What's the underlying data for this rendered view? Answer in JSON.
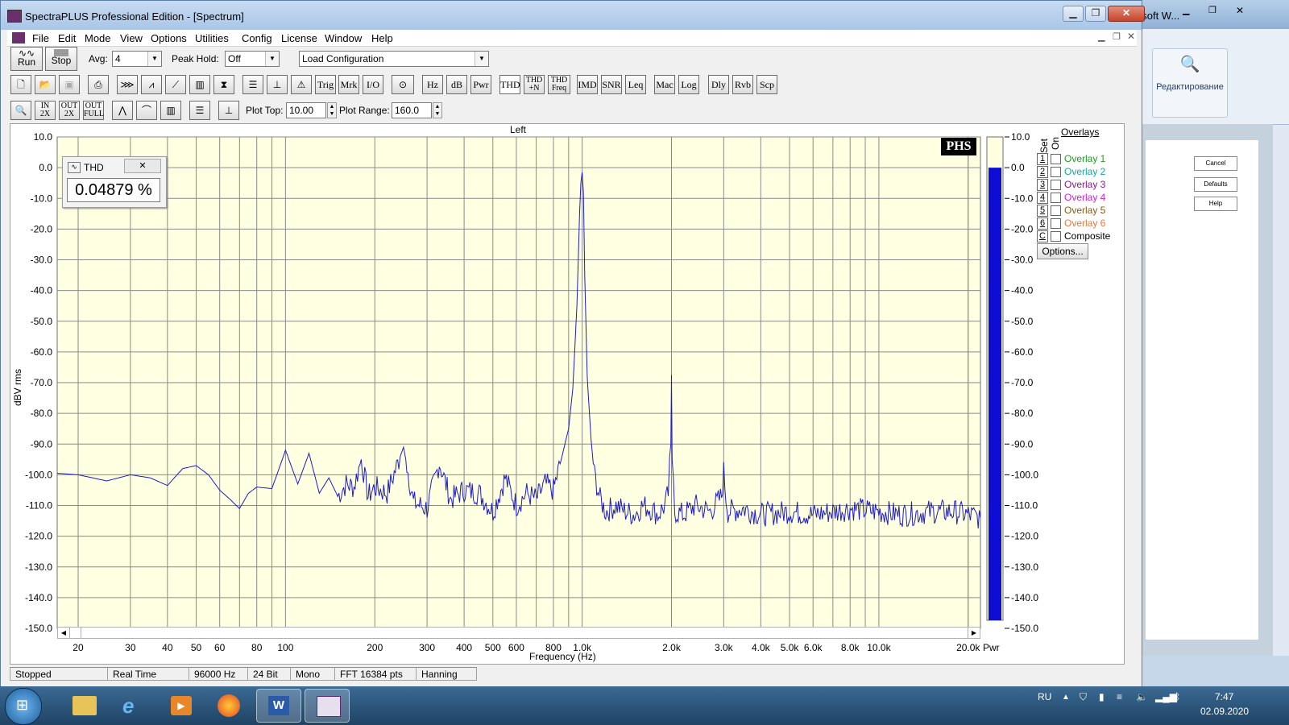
{
  "window": {
    "title": "SpectraPLUS Professional Edition - [Spectrum]",
    "menu": [
      "File",
      "Edit",
      "Mode",
      "View",
      "Options",
      "Utilities",
      "Config",
      "License",
      "Window",
      "Help"
    ]
  },
  "toolbar1": {
    "run_label": "Run",
    "stop_label": "Stop",
    "avg_label": "Avg:",
    "avg_value": "4",
    "peak_hold_label": "Peak Hold:",
    "peak_hold_value": "Off",
    "config_value": "Load Configuration"
  },
  "toolbar2": {
    "buttons": [
      "Trig",
      "Mrk",
      "I/O",
      "Hz",
      "dB",
      "Pwr",
      "THD",
      "THD +N",
      "THD Freq",
      "IMD",
      "SNR",
      "Leq",
      "Mac",
      "Log",
      "Dly",
      "Rvb",
      "Scp"
    ]
  },
  "toolbar3": {
    "zoom_labels": [
      "IN 2X",
      "OUT 2X",
      "OUT FULL"
    ],
    "plot_top_label": "Plot Top:",
    "plot_top_value": "10.00",
    "plot_range_label": "Plot Range:",
    "plot_range_value": "160.0"
  },
  "plot": {
    "channel": "Left",
    "brand": "PHS",
    "ylabel": "dBV rms",
    "xlabel": "Frequency (Hz)",
    "pwr_label": "Pwr",
    "pwr_level_db": 0.0,
    "thd_title": "THD",
    "thd_value": "0.04879 %",
    "y_ticks": [
      "10.0",
      "0.0",
      "-10.0",
      "-20.0",
      "-30.0",
      "-40.0",
      "-50.0",
      "-60.0",
      "-70.0",
      "-80.0",
      "-90.0",
      "-100.0",
      "-110.0",
      "-120.0",
      "-130.0",
      "-140.0",
      "-150.0"
    ],
    "x_ticks": [
      {
        "f": 20,
        "label": "20"
      },
      {
        "f": 30,
        "label": "30"
      },
      {
        "f": 40,
        "label": "40"
      },
      {
        "f": 50,
        "label": "50"
      },
      {
        "f": 60,
        "label": "60"
      },
      {
        "f": 80,
        "label": "80"
      },
      {
        "f": 100,
        "label": "100"
      },
      {
        "f": 200,
        "label": "200"
      },
      {
        "f": 300,
        "label": "300"
      },
      {
        "f": 400,
        "label": "400"
      },
      {
        "f": 500,
        "label": "500"
      },
      {
        "f": 600,
        "label": "600"
      },
      {
        "f": 800,
        "label": "800"
      },
      {
        "f": 1000,
        "label": "1.0k"
      },
      {
        "f": 2000,
        "label": "2.0k"
      },
      {
        "f": 3000,
        "label": "3.0k"
      },
      {
        "f": 4000,
        "label": "4.0k"
      },
      {
        "f": 5000,
        "label": "5.0k"
      },
      {
        "f": 6000,
        "label": "6.0k"
      },
      {
        "f": 8000,
        "label": "8.0k"
      },
      {
        "f": 10000,
        "label": "10.0k"
      },
      {
        "f": 20000,
        "label": "20.0k"
      }
    ]
  },
  "overlays": {
    "title": "Overlays",
    "set_label": "Set",
    "on_label": "On",
    "items": [
      {
        "key": "1",
        "label": "Overlay 1",
        "color": "#1e9b1e"
      },
      {
        "key": "2",
        "label": "Overlay 2",
        "color": "#1aa5a5"
      },
      {
        "key": "3",
        "label": "Overlay 3",
        "color": "#8b1a8b"
      },
      {
        "key": "4",
        "label": "Overlay 4",
        "color": "#d31ed3"
      },
      {
        "key": "5",
        "label": "Overlay 5",
        "color": "#8a5a1a"
      },
      {
        "key": "6",
        "label": "Overlay 6",
        "color": "#e07a40"
      },
      {
        "key": "C",
        "label": "Composite",
        "color": "#000000"
      }
    ],
    "options_label": "Options..."
  },
  "status": {
    "state": "Stopped",
    "mode": "Real Time",
    "rate": "96000 Hz",
    "bits": "24 Bit",
    "channels": "Mono",
    "fft": "FFT 16384 pts",
    "window": "Hanning"
  },
  "background_window": {
    "title_fragment": "osoft W...",
    "ribbon_label": "Редактирование",
    "dialog_buttons": [
      "Cancel",
      "Defaults",
      "Help"
    ]
  },
  "taskbar": {
    "lang": "RU",
    "time": "7:47",
    "date": "02.09.2020"
  },
  "chart_data": {
    "type": "line",
    "title": "Left",
    "xlabel": "Frequency (Hz)",
    "ylabel": "dBV rms",
    "xscale": "log",
    "xlim": [
      17,
      22000
    ],
    "ylim": [
      -150,
      10
    ],
    "series": [
      {
        "color": "#1d1dc8",
        "x": [
          17,
          20,
          25,
          30,
          35,
          40,
          45,
          50,
          55,
          60,
          65,
          70,
          75,
          80,
          90,
          100,
          110,
          120,
          130,
          140,
          150,
          160,
          170,
          180,
          190,
          200,
          220,
          250,
          270,
          300,
          330,
          360,
          400,
          450,
          500,
          550,
          600,
          650,
          700,
          750,
          800,
          850,
          900,
          930,
          960,
          980,
          990,
          1000,
          1010,
          1020,
          1040,
          1070,
          1100,
          1150,
          1200,
          1300,
          1400,
          1500,
          1600,
          1700,
          1800,
          1900,
          1950,
          1990,
          2000,
          2010,
          2050,
          2200,
          2400,
          2700,
          2900,
          2950,
          3000,
          3050,
          3100,
          3500,
          4000,
          5000,
          6000,
          7000,
          8000,
          10000,
          12000,
          15000,
          18000,
          20000,
          22000
        ],
        "y": [
          -99.5,
          -100,
          -102,
          -100,
          -101,
          -103.5,
          -98,
          -97,
          -100,
          -105,
          -108,
          -111,
          -106,
          -104,
          -104.5,
          -92,
          -103,
          -93,
          -106,
          -101,
          -107,
          -103,
          -104,
          -95,
          -107,
          -104,
          -106,
          -91,
          -109,
          -111,
          -96,
          -108,
          -105,
          -106,
          -112,
          -101,
          -110,
          -106,
          -108,
          -103,
          -105,
          -95,
          -85,
          -72,
          -45,
          -15,
          -5,
          -1.5,
          -8,
          -35,
          -68,
          -88,
          -100,
          -108,
          -112,
          -110,
          -112,
          -113,
          -110,
          -111,
          -113,
          -110,
          -106,
          -90,
          -67.5,
          -95,
          -112,
          -113,
          -110,
          -112,
          -108,
          -107,
          -99,
          -107,
          -112,
          -111,
          -113,
          -112,
          -113,
          -112,
          -111,
          -112,
          -113,
          -112,
          -112,
          -113,
          -114
        ]
      }
    ]
  }
}
